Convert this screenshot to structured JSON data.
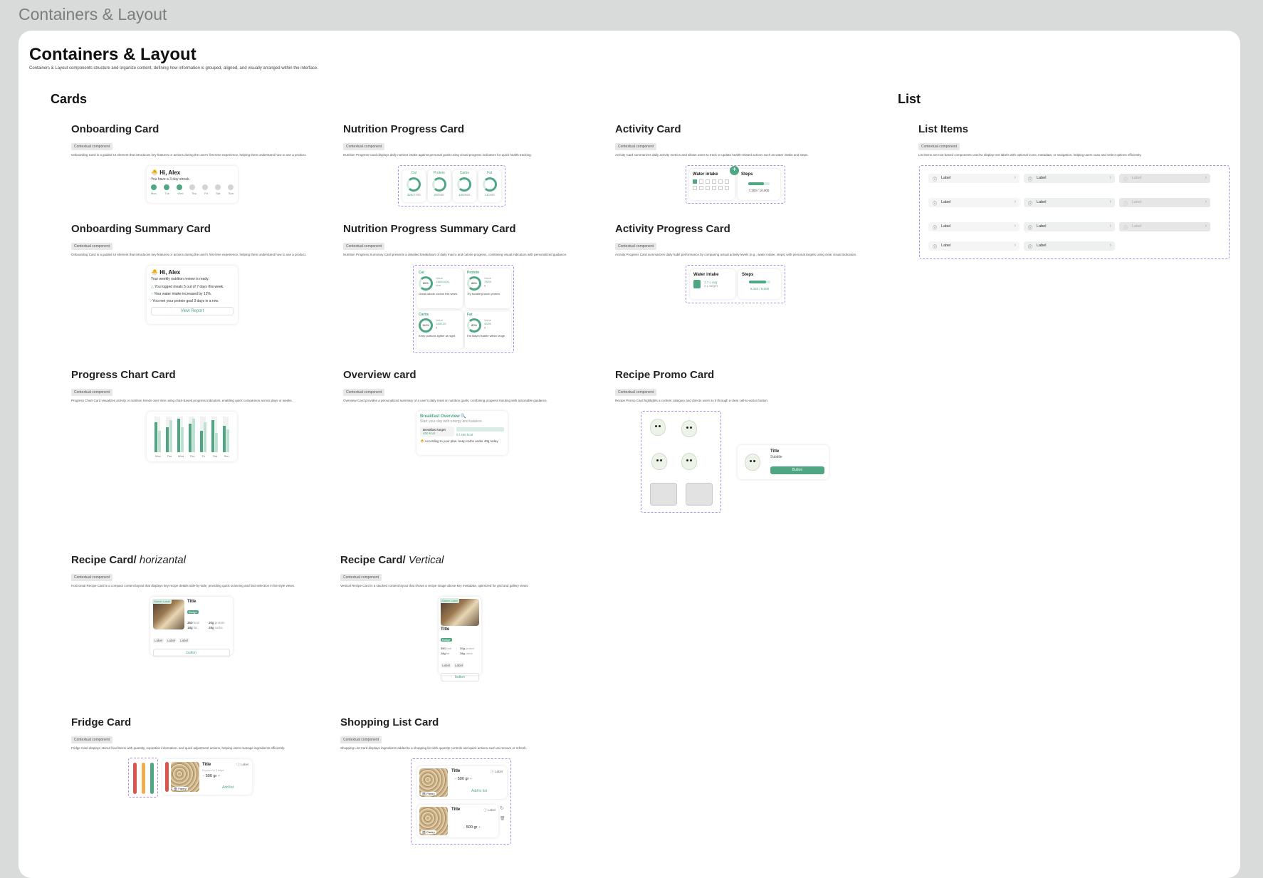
{
  "frame_label": "Containers & Layout",
  "page": {
    "title": "Containers & Layout",
    "description": "Containers & Layout components structure and organize content, defining how information is grouped, aligned, and visually arranged within the interface."
  },
  "groups": {
    "cards": "Cards",
    "list": "List"
  },
  "tag": "Contextual component",
  "sections": {
    "onboarding": {
      "title": "Onboarding Card",
      "desc": "Onboarding Card is a guided UI element that introduces key features or actions during the user's first-time experience, helping them understand how to use a product."
    },
    "nutrition_progress": {
      "title": "Nutrition Progress Card",
      "desc": "Nutrition Progress Card displays daily nutrient intake against personal goals using visual progress indicators for quick health tracking."
    },
    "activity": {
      "title": "Activity Card",
      "desc": "Activity Card summarizes daily activity metrics and allows users to track or update health-related actions such as water intake and steps."
    },
    "list_items": {
      "title": "List Items",
      "desc": "List items are row-based components used to display text labels with optional icons, metadata, or navigation, helping users scan and select options efficiently."
    },
    "onboarding_summary": {
      "title": "Onboarding Summary Card",
      "desc": "Onboarding Card is a guided UI element that introduces key features or actions during the user's first-time experience, helping them understand how to use a product."
    },
    "nutrition_summary": {
      "title": "Nutrition Progress Summary Card",
      "desc": "Nutrition Progress Summary Card presents a detailed breakdown of daily macro and calorie progress, combining visual indicators with personalized guidance."
    },
    "activity_progress": {
      "title": "Activity Progress Card",
      "desc": "Activity Progress Card summarizes daily habit performance by comparing actual activity levels (e.g., water intake, steps) with personal targets using clear visual indicators."
    },
    "progress_chart": {
      "title": "Progress Chart Card",
      "desc": "Progress Chart Card visualizes activity or nutrition trends over time using chart-based progress indicators, enabling quick comparison across days or weeks."
    },
    "overview": {
      "title": "Overview card",
      "desc": "Overview Card provides a personalized summary of a user's daily meal or nutrition goals, combining progress tracking with actionable guidance."
    },
    "recipe_promo": {
      "title": "Recipe Promo Card",
      "desc": "Recipe Promo Card highlights a content category and directs users to it through a clear call-to-action button."
    },
    "recipe_h": {
      "title": "Recipe Card/",
      "title_it": "horizantal",
      "desc": "Horizontal Recipe Card is a compact content layout that displays key recipe details side-by-side, providing quick scanning and fast selection in list-style views."
    },
    "recipe_v": {
      "title": "Recipe Card/",
      "title_it": "Vertical",
      "desc": "Vertical Recipe Card is a stacked content layout that shows a recipe image above key metadata, optimized for grid and gallery views."
    },
    "fridge": {
      "title": "Fridge Card",
      "desc": "Fridge Card displays stored food items with quantity, expiration information, and quick adjustment actions, helping users manage ingredients efficiently."
    },
    "shopping": {
      "title": "Shopping List Card",
      "desc": "Shopping List Card displays ingredients added to a shopping list with quantity controls and quick actions such as remove or refresh."
    }
  },
  "onboarding_card": {
    "greeting": "Hi, Alex",
    "sub": "You have a 3 day streak.",
    "days": [
      "Mon",
      "Tue",
      "Wed",
      "Thu",
      "Fri",
      "Sat",
      "Sun"
    ]
  },
  "nutrition_card": {
    "items": [
      {
        "label": "Cal",
        "value": "420",
        "goal": "/2700"
      },
      {
        "label": "Protein",
        "value": "25",
        "goal": "/550"
      },
      {
        "label": "Carbs",
        "value": "105",
        "goal": "/960"
      },
      {
        "label": "Fat",
        "value": "11",
        "goal": "/280"
      }
    ]
  },
  "activity_card": {
    "water": "Water intake",
    "steps": "Steps",
    "steps_value": "7,200 / 10,000",
    "add_icon": "plus-icon"
  },
  "summary_card": {
    "greeting": "Hi, Alex",
    "sub": "Your weekly nutrition review is ready.",
    "points": [
      "You logged meals 5 out of 7 days this week.",
      "Your water intake increased by 12%.",
      "You met your protein goal 3 days in a row."
    ],
    "button": "View Report"
  },
  "nutrition_summary_card": {
    "items": [
      {
        "label": "Cal",
        "pct": "85%",
        "stat_label": "Value",
        "stat": "1460/1600",
        "unit": "kcal",
        "note": "Great calorie control this week."
      },
      {
        "label": "Protein",
        "pct": "88%",
        "stat_label": "Value",
        "stat": "78/90",
        "unit": "g",
        "note": "Try boosting lunch protein."
      },
      {
        "label": "Carbs",
        "pct": "114%",
        "stat_label": "Value",
        "stat": "148/130",
        "unit": "g",
        "note": "Keep portions lighter at night."
      },
      {
        "label": "Fat",
        "pct": "80%",
        "stat_label": "Value",
        "stat": "40/50",
        "unit": "g",
        "note": "Fat stayed stable within range."
      }
    ]
  },
  "activity_progress_card": {
    "water": "Water intake",
    "water_value": "1.7 L avg",
    "water_target": "2 L target",
    "steps": "Steps",
    "steps_value": "6,320 / 8,000"
  },
  "chart_data": {
    "type": "bar",
    "categories": [
      "Mon",
      "Tue",
      "Wed",
      "Thu",
      "Fri",
      "Sat",
      "Sun"
    ],
    "series": [
      {
        "values": [
          85,
          70,
          95,
          80,
          60,
          90,
          75
        ]
      },
      {
        "values": [
          60,
          90,
          70,
          95,
          85,
          55,
          65
        ]
      }
    ],
    "ylim": [
      0,
      100
    ]
  },
  "overview_card": {
    "title": "Breakfast Overview",
    "sub": "Start your day with energy and balance.",
    "target_label": "Breakfast target",
    "target_value": "450 kcal",
    "progress": "0 / 450 kcal",
    "tip": "According to your plan, keep carbs under 40g today"
  },
  "promo_card": {
    "title": "Title",
    "subtitle": "Subtitle",
    "button": "Button"
  },
  "recipe_h_card": {
    "badge": "Starter Label",
    "title": "Title",
    "pill": "Badge",
    "kcal": "350",
    "kcal_u": "kcal",
    "protein": "20g",
    "protein_u": "protein",
    "fat": "18g",
    "fat_u": "fat",
    "carbs": "28g",
    "carbs_u": "carbs",
    "chips": [
      "Label",
      "Label",
      "Label"
    ],
    "button": "button"
  },
  "recipe_v_card": {
    "badge": "Starter Label",
    "title": "Title",
    "pill": "Badge",
    "kcal": "350",
    "kcal_u": "kcal",
    "protein": "20g",
    "protein_u": "protein",
    "fat": "18g",
    "fat_u": "fat",
    "carbs": "28g",
    "carbs_u": "carbs",
    "chips": [
      "Label",
      "Label"
    ],
    "button": "button"
  },
  "fridge_card": {
    "title": "Title",
    "meta": "Expires in 3 days",
    "label": "Label",
    "qty": "500 gr",
    "tag": "Pantry",
    "action": "Add list"
  },
  "shopping_card": [
    {
      "title": "Title",
      "label": "Label",
      "qty": "500 gr",
      "tag": "Pantry",
      "action": "Add to list"
    },
    {
      "title": "Title",
      "label": "Label",
      "qty": "500 gr",
      "tag": "Pantry"
    }
  ],
  "list": {
    "label": "Label"
  }
}
